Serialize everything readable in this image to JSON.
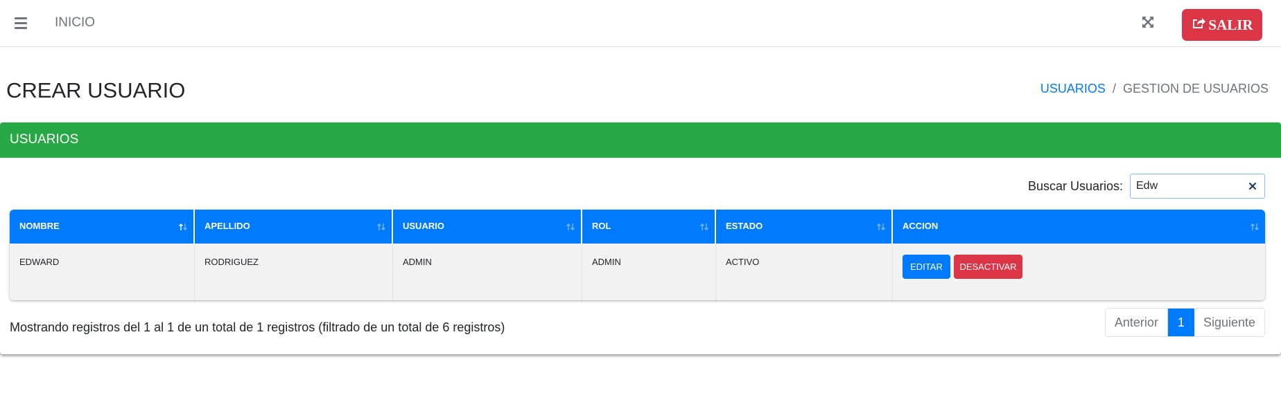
{
  "navbar": {
    "menu_icon": "hamburger-icon",
    "home_link": "INICIO",
    "fullscreen_icon": "expand-icon",
    "logout_label": "SALIR",
    "logout_icon": "share-square-icon"
  },
  "header": {
    "title": "CREAR USUARIO",
    "breadcrumb": {
      "link": "USUARIOS",
      "separator": "/",
      "active": "GESTION DE USUARIOS"
    }
  },
  "card": {
    "title": "USUARIOS",
    "search": {
      "label": "Buscar Usuarios:",
      "value": "Edw"
    },
    "table": {
      "columns": [
        "NOMBRE",
        "APELLIDO",
        "USUARIO",
        "ROL",
        "ESTADO",
        "ACCION"
      ],
      "rows": [
        {
          "nombre": "EDWARD",
          "apellido": "RODRIGUEZ",
          "usuario": "ADMIN",
          "rol": "ADMIN",
          "estado": "ACTIVO",
          "edit_label": "EDITAR",
          "deactivate_label": "DESACTIVAR"
        }
      ]
    },
    "info": "Mostrando registros del 1 al 1 de un total de 1 registros (filtrado de un total de 6 registros)",
    "pagination": {
      "prev": "Anterior",
      "current": "1",
      "next": "Siguiente"
    }
  },
  "colors": {
    "primary": "#007bff",
    "success": "#28a745",
    "danger": "#dc3545"
  }
}
